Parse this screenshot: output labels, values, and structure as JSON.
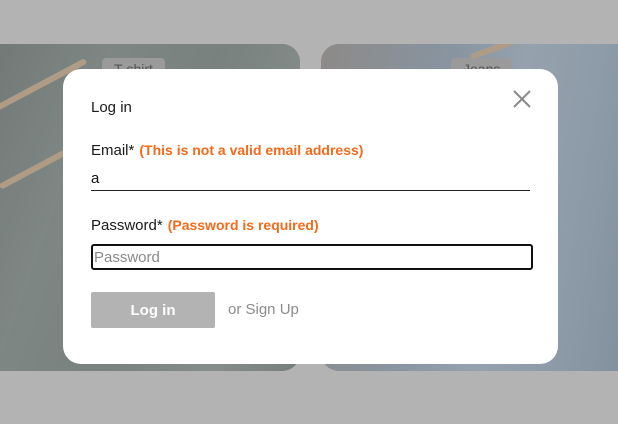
{
  "background_cards": {
    "left_tag": "T-shirt",
    "right_tag": "Jeans"
  },
  "modal": {
    "title": "Log in",
    "close_icon": "close-icon",
    "email": {
      "label": "Email*",
      "error": "(This is not a valid email address)",
      "value": "a"
    },
    "password": {
      "label": "Password*",
      "error": "(Password is required)",
      "placeholder": "Password",
      "value": ""
    },
    "login_button": "Log in",
    "signup_link": "or Sign Up"
  },
  "colors": {
    "error": "#f26a1b",
    "button_disabled": "#b3b3b3",
    "overlay": "#b3b3b3"
  }
}
